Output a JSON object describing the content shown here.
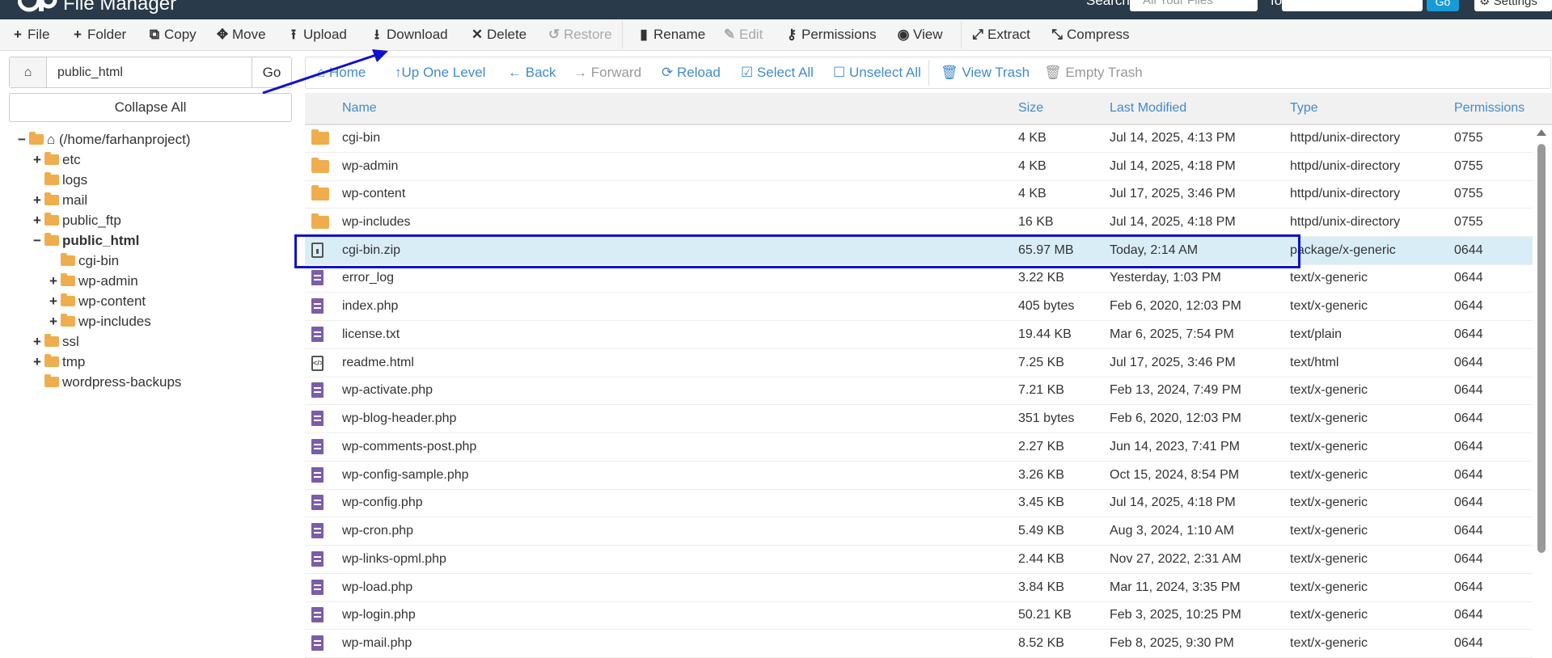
{
  "header": {
    "app_title": "File Manager",
    "search_label": "Search",
    "search_scope": "All Your Files",
    "for_label": "for",
    "go_label": "Go",
    "settings_label": "Settings"
  },
  "toolbar": {
    "file": "File",
    "folder": "Folder",
    "copy": "Copy",
    "move": "Move",
    "upload": "Upload",
    "download": "Download",
    "delete": "Delete",
    "restore": "Restore",
    "rename": "Rename",
    "edit": "Edit",
    "permissions": "Permissions",
    "view": "View",
    "extract": "Extract",
    "compress": "Compress"
  },
  "sidebar": {
    "path_value": "public_html",
    "go_label": "Go",
    "collapse_label": "Collapse All",
    "tree": [
      {
        "label": "(/home/farhanproject)",
        "expander": "−"
      },
      {
        "label": "etc",
        "expander": "+"
      },
      {
        "label": "logs",
        "expander": ""
      },
      {
        "label": "mail",
        "expander": "+"
      },
      {
        "label": "public_ftp",
        "expander": "+"
      },
      {
        "label": "public_html",
        "expander": "−"
      },
      {
        "label": "cgi-bin",
        "expander": ""
      },
      {
        "label": "wp-admin",
        "expander": "+"
      },
      {
        "label": "wp-content",
        "expander": "+"
      },
      {
        "label": "wp-includes",
        "expander": "+"
      },
      {
        "label": "ssl",
        "expander": "+"
      },
      {
        "label": "tmp",
        "expander": "+"
      },
      {
        "label": "wordpress-backups",
        "expander": ""
      }
    ]
  },
  "nav": {
    "home": "Home",
    "up": "Up One Level",
    "back": "Back",
    "forward": "Forward",
    "reload": "Reload",
    "select_all": "Select All",
    "unselect_all": "Unselect All",
    "view_trash": "View Trash",
    "empty_trash": "Empty Trash"
  },
  "table": {
    "headers": {
      "name": "Name",
      "size": "Size",
      "modified": "Last Modified",
      "type": "Type",
      "perms": "Permissions"
    },
    "rows": [
      {
        "name": "cgi-bin",
        "size": "4 KB",
        "modified": "Jul 14, 2025, 4:13 PM",
        "type": "httpd/unix-directory",
        "perms": "0755"
      },
      {
        "name": "wp-admin",
        "size": "4 KB",
        "modified": "Jul 14, 2025, 4:18 PM",
        "type": "httpd/unix-directory",
        "perms": "0755"
      },
      {
        "name": "wp-content",
        "size": "4 KB",
        "modified": "Jul 17, 2025, 3:46 PM",
        "type": "httpd/unix-directory",
        "perms": "0755"
      },
      {
        "name": "wp-includes",
        "size": "16 KB",
        "modified": "Jul 14, 2025, 4:18 PM",
        "type": "httpd/unix-directory",
        "perms": "0755"
      },
      {
        "name": "cgi-bin.zip",
        "size": "65.97 MB",
        "modified": "Today, 2:14 AM",
        "type": "package/x-generic",
        "perms": "0644"
      },
      {
        "name": "error_log",
        "size": "3.22 KB",
        "modified": "Yesterday, 1:03 PM",
        "type": "text/x-generic",
        "perms": "0644"
      },
      {
        "name": "index.php",
        "size": "405 bytes",
        "modified": "Feb 6, 2020, 12:03 PM",
        "type": "text/x-generic",
        "perms": "0644"
      },
      {
        "name": "license.txt",
        "size": "19.44 KB",
        "modified": "Mar 6, 2025, 7:54 PM",
        "type": "text/plain",
        "perms": "0644"
      },
      {
        "name": "readme.html",
        "size": "7.25 KB",
        "modified": "Jul 17, 2025, 3:46 PM",
        "type": "text/html",
        "perms": "0644"
      },
      {
        "name": "wp-activate.php",
        "size": "7.21 KB",
        "modified": "Feb 13, 2024, 7:49 PM",
        "type": "text/x-generic",
        "perms": "0644"
      },
      {
        "name": "wp-blog-header.php",
        "size": "351 bytes",
        "modified": "Feb 6, 2020, 12:03 PM",
        "type": "text/x-generic",
        "perms": "0644"
      },
      {
        "name": "wp-comments-post.php",
        "size": "2.27 KB",
        "modified": "Jun 14, 2023, 7:41 PM",
        "type": "text/x-generic",
        "perms": "0644"
      },
      {
        "name": "wp-config-sample.php",
        "size": "3.26 KB",
        "modified": "Oct 15, 2024, 8:54 PM",
        "type": "text/x-generic",
        "perms": "0644"
      },
      {
        "name": "wp-config.php",
        "size": "3.45 KB",
        "modified": "Jul 14, 2025, 4:18 PM",
        "type": "text/x-generic",
        "perms": "0644"
      },
      {
        "name": "wp-cron.php",
        "size": "5.49 KB",
        "modified": "Aug 3, 2024, 1:10 AM",
        "type": "text/x-generic",
        "perms": "0644"
      },
      {
        "name": "wp-links-opml.php",
        "size": "2.44 KB",
        "modified": "Nov 27, 2022, 2:31 AM",
        "type": "text/x-generic",
        "perms": "0644"
      },
      {
        "name": "wp-load.php",
        "size": "3.84 KB",
        "modified": "Mar 11, 2024, 3:35 PM",
        "type": "text/x-generic",
        "perms": "0644"
      },
      {
        "name": "wp-login.php",
        "size": "50.21 KB",
        "modified": "Feb 3, 2025, 10:25 PM",
        "type": "text/x-generic",
        "perms": "0644"
      },
      {
        "name": "wp-mail.php",
        "size": "8.52 KB",
        "modified": "Feb 8, 2025, 9:30 PM",
        "type": "text/x-generic",
        "perms": "0644"
      }
    ]
  },
  "colors": {
    "link": "#428bca",
    "highlight": "#1010d0",
    "selected_row": "#d9edf7",
    "header_bg": "#293a4a"
  }
}
